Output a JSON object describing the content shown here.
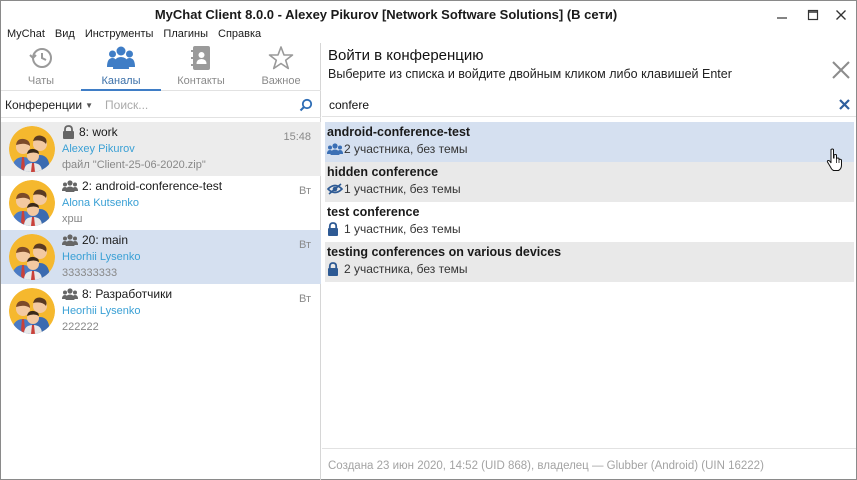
{
  "window": {
    "title": "MyChat Client 8.0.0 - Alexey Pikurov [Network Software Solutions] (В сети)"
  },
  "menu": [
    "MyChat",
    "Вид",
    "Инструменты",
    "Плагины",
    "Справка"
  ],
  "tabs": [
    {
      "label": "Чаты",
      "icon": "history-icon",
      "active": false
    },
    {
      "label": "Каналы",
      "icon": "users-icon",
      "active": true
    },
    {
      "label": "Контакты",
      "icon": "contacts-book-icon",
      "active": false
    },
    {
      "label": "Важное",
      "icon": "star-icon",
      "active": false
    }
  ],
  "left_search": {
    "filter_label": "Конференции",
    "placeholder": "Поиск..."
  },
  "chats": [
    {
      "title": "8: work",
      "user": "Alexey Pikurov",
      "message": "файл \"Client-25-06-2020.zip\"",
      "time": "15:48",
      "icon": "lock-icon"
    },
    {
      "title": "2: android-conference-test",
      "user": "Alona Kutsenko",
      "message": "хрш",
      "time": "Вт",
      "icon": "group-icon"
    },
    {
      "title": "20: main",
      "user": "Heorhii Lysenko",
      "message": "333333333",
      "time": "Вт",
      "icon": "group-icon"
    },
    {
      "title": "8: Разработчики",
      "user": "Heorhii Lysenko",
      "message": "222222",
      "time": "Вт",
      "icon": "group-icon"
    }
  ],
  "right": {
    "title": "Войти в конференцию",
    "subtitle": "Выберите из списка и войдите двойным кликом либо клавишей Enter",
    "search_value": "confere"
  },
  "conferences": [
    {
      "name": "android-conference-test",
      "info": "2 участника, без темы",
      "icon": "group-icon"
    },
    {
      "name": "hidden conference",
      "info": "1 участник, без темы",
      "icon": "hidden-eye-icon"
    },
    {
      "name": "test conference",
      "info": "1 участник, без темы",
      "icon": "lock-icon"
    },
    {
      "name": "testing conferences on various devices",
      "info": "2 участника, без темы",
      "icon": "lock-icon"
    }
  ],
  "footer": {
    "text": "Создана 23 июн 2020, 14:52 (UID 868), владелец — Glubber (Android) (UIN 16222)"
  },
  "colors": {
    "accent": "#3f7dc6",
    "selection": "#d5e0f0",
    "username": "#3aa0d5"
  }
}
